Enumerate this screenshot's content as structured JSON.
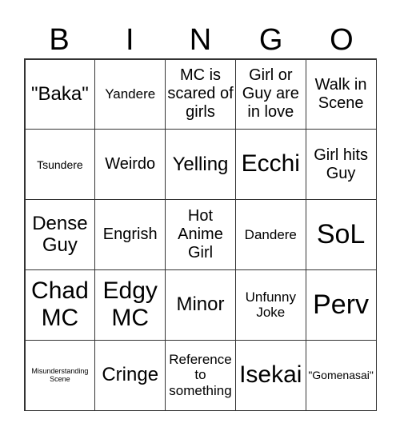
{
  "header": [
    "B",
    "I",
    "N",
    "G",
    "O"
  ],
  "cells": [
    [
      "\"Baka\"",
      "Yandere",
      "MC is scared of girls",
      "Girl or Guy are in love",
      "Walk in Scene"
    ],
    [
      "Tsundere",
      "Weirdo",
      "Yelling",
      "Ecchi",
      "Girl hits Guy"
    ],
    [
      "Dense Guy",
      "Engrish",
      "Hot Anime Girl",
      "Dandere",
      "SoL"
    ],
    [
      "Chad MC",
      "Edgy MC",
      "Minor",
      "Unfunny Joke",
      "Perv"
    ],
    [
      "Misunderstanding Scene",
      "Cringe",
      "Reference to something",
      "Isekai",
      "\"Gomenasai\""
    ]
  ]
}
